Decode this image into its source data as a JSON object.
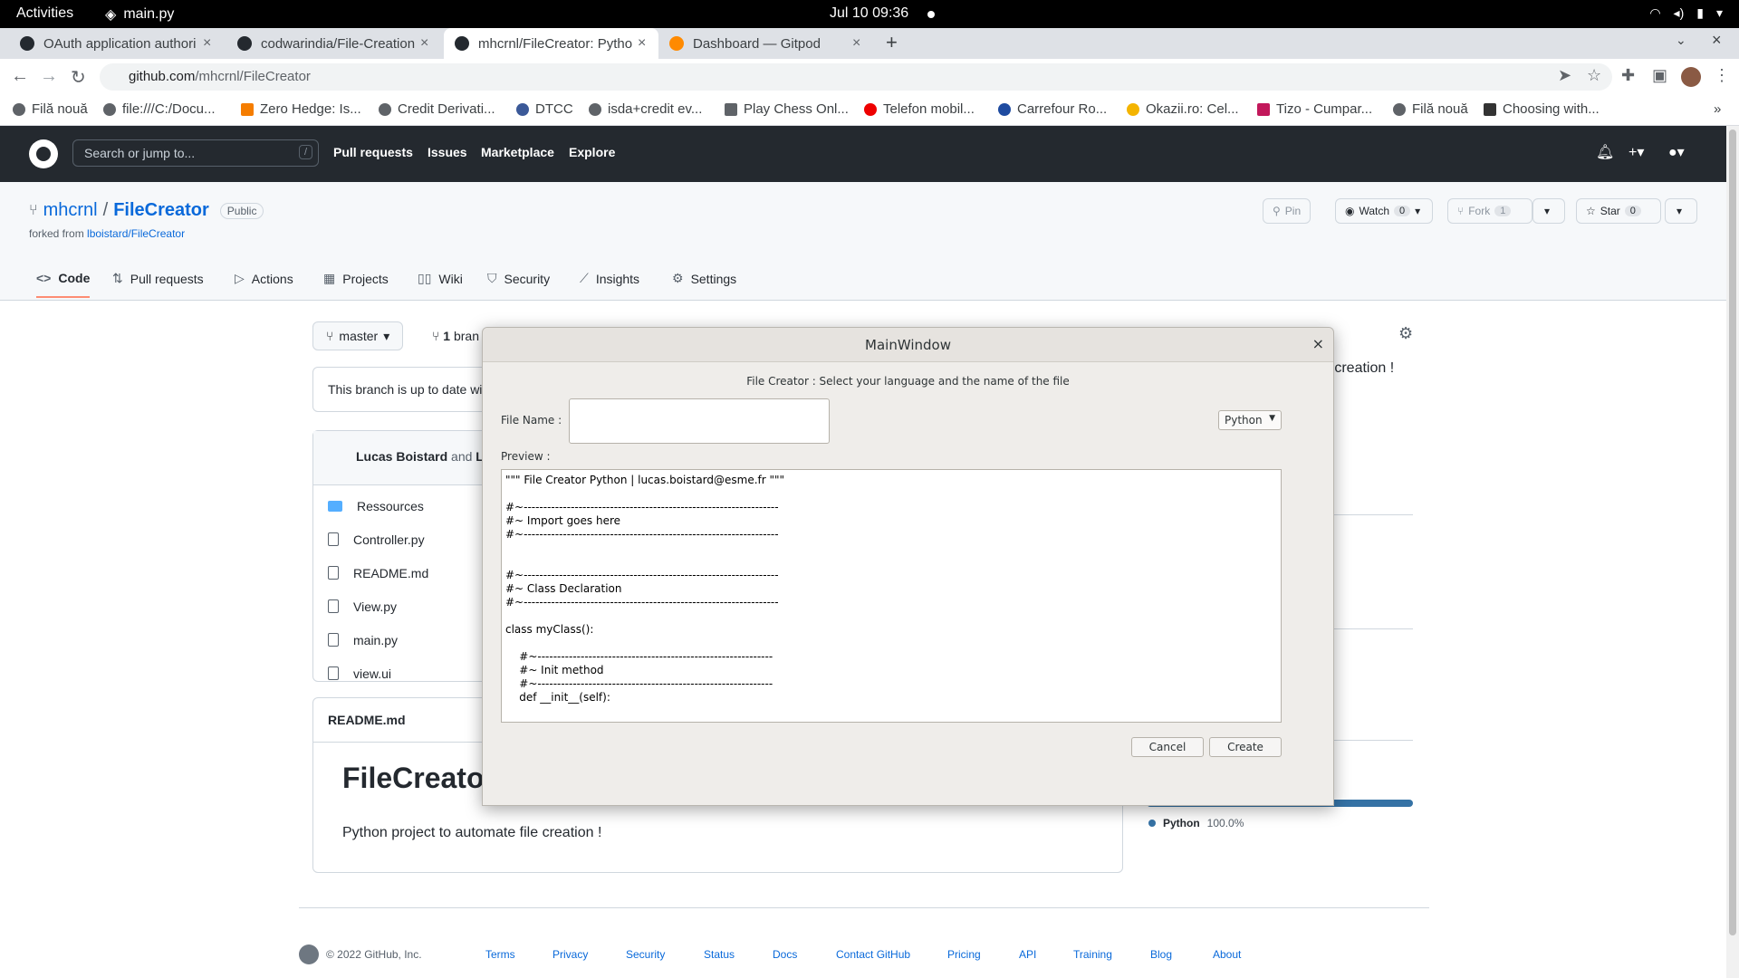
{
  "system": {
    "activities": "Activities",
    "app": "main.py",
    "clock": "Jul 10  09:36"
  },
  "browser": {
    "tabs": [
      {
        "title": "OAuth application authori",
        "active": false
      },
      {
        "title": "codwarindia/File-Creation",
        "active": false
      },
      {
        "title": "mhcrnl/FileCreator: Pytho",
        "active": true
      },
      {
        "title": "Dashboard — Gitpod",
        "active": false
      }
    ],
    "url_host": "github.com",
    "url_path": "/mhcrnl/FileCreator",
    "bookmarks": [
      "Filă nouă",
      "file:///C:/Docu...",
      "Zero Hedge: Is...",
      "Credit Derivati...",
      "DTCC",
      "isda+credit ev...",
      "Play Chess Onl...",
      "Telefon mobil...",
      "Carrefour Ro...",
      "Okazii.ro: Cel...",
      "Tizo - Cumpar...",
      "Filă nouă",
      "Choosing with..."
    ]
  },
  "github": {
    "search_placeholder": "Search or jump to...",
    "search_key": "/",
    "nav": [
      "Pull requests",
      "Issues",
      "Marketplace",
      "Explore"
    ],
    "owner": "mhcrnl",
    "repo": "FileCreator",
    "visibility": "Public",
    "forked_prefix": "forked from",
    "forked_from": "lboistard/FileCreator",
    "pin": "Pin",
    "watch": "Watch",
    "watch_count": "0",
    "fork": "Fork",
    "fork_count": "1",
    "star": "Star",
    "star_count": "0",
    "tabs": [
      "Code",
      "Pull requests",
      "Actions",
      "Projects",
      "Wiki",
      "Security",
      "Insights",
      "Settings"
    ],
    "branch": "master",
    "branches_count": "1",
    "branches_label": "bran",
    "branch_status": "This branch is up to date wi",
    "commit_author": "Lucas Boistard",
    "commit_and": "and",
    "commit_other": "L",
    "files": [
      "Ressources",
      "Controller.py",
      "README.md",
      "View.py",
      "main.py",
      "view.ui"
    ],
    "readme_header": "README.md",
    "readme_title": "FileCreato",
    "readme_text": "Python project to automate file creation !",
    "about_desc": "e creation !",
    "language": "Python",
    "language_pct": "100.0%",
    "footer_copy": "© 2022 GitHub, Inc.",
    "footer_links": [
      "Terms",
      "Privacy",
      "Security",
      "Status",
      "Docs",
      "Contact GitHub",
      "Pricing",
      "API",
      "Training",
      "Blog",
      "About"
    ]
  },
  "dialog": {
    "title": "MainWindow",
    "close": "×",
    "subtitle": "File Creator : Select your language and the name of the file",
    "file_name_label": "File Name :",
    "file_name_value": "",
    "language": "Python",
    "preview_label": "Preview :",
    "preview_text": "\"\"\" File Creator Python | lucas.boistard@esme.fr \"\"\"\n\n#~-----------------------------------------------------------------\n#~ Import goes here\n#~-----------------------------------------------------------------\n\n\n#~-----------------------------------------------------------------\n#~ Class Declaration\n#~-----------------------------------------------------------------\n\nclass myClass():\n\n    #~------------------------------------------------------------\n    #~ Init method\n    #~------------------------------------------------------------\n    def __init__(self):",
    "cancel": "Cancel",
    "create": "Create"
  },
  "colors": {
    "github_header": "#24292f",
    "link": "#0969da",
    "python": "#3572a5"
  }
}
